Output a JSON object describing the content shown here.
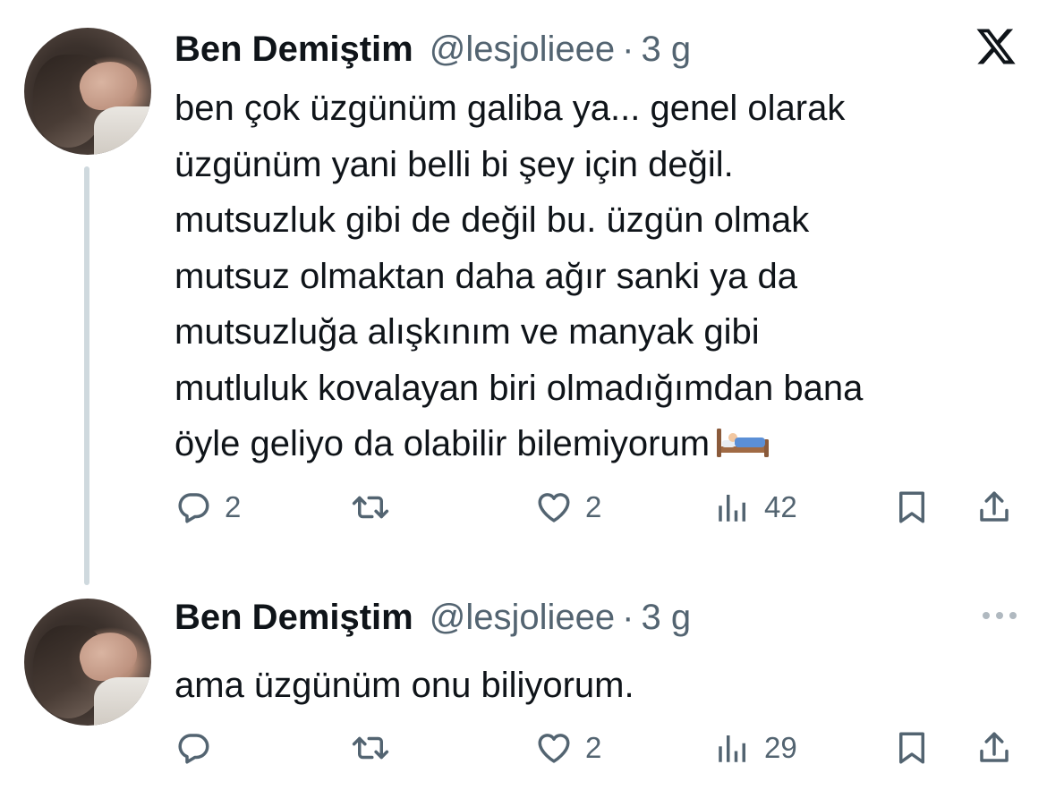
{
  "tweets": [
    {
      "author_name": "Ben Demiştim",
      "handle": "@lesjolieee",
      "separator": "·",
      "time": "3 g",
      "text_lines": [
        "ben çok üzgünüm galiba ya... genel olarak",
        "üzgünüm yani belli bi şey için değil.",
        "mutsuzluk gibi de değil bu. üzgün olmak",
        "mutsuz olmaktan daha ağır sanki ya da",
        "mutsuzluğa alışkınım ve manyak gibi",
        "mutluluk kovalayan biri olmadığımdan bana",
        "öyle geliyo da olabilir bilemiyorum"
      ],
      "emoji_icon": "bed-icon",
      "replies": "2",
      "reposts": "",
      "likes": "2",
      "views": "42"
    },
    {
      "author_name": "Ben Demiştim",
      "handle": "@lesjolieee",
      "separator": "·",
      "time": "3 g",
      "text_lines": [
        "ama üzgünüm onu biliyorum."
      ],
      "replies": "",
      "reposts": "",
      "likes": "2",
      "views": "29"
    }
  ],
  "icons": {
    "brand": "x-logo-icon",
    "more": "more-dots-icon",
    "reply": "reply-icon",
    "retweet": "retweet-icon",
    "like": "heart-icon",
    "views": "views-chart-icon",
    "bookmark": "bookmark-icon",
    "share": "share-icon"
  },
  "colors": {
    "text": "#0f1419",
    "secondary": "#536471",
    "thread_line": "#cfd9de",
    "background": "#ffffff"
  }
}
